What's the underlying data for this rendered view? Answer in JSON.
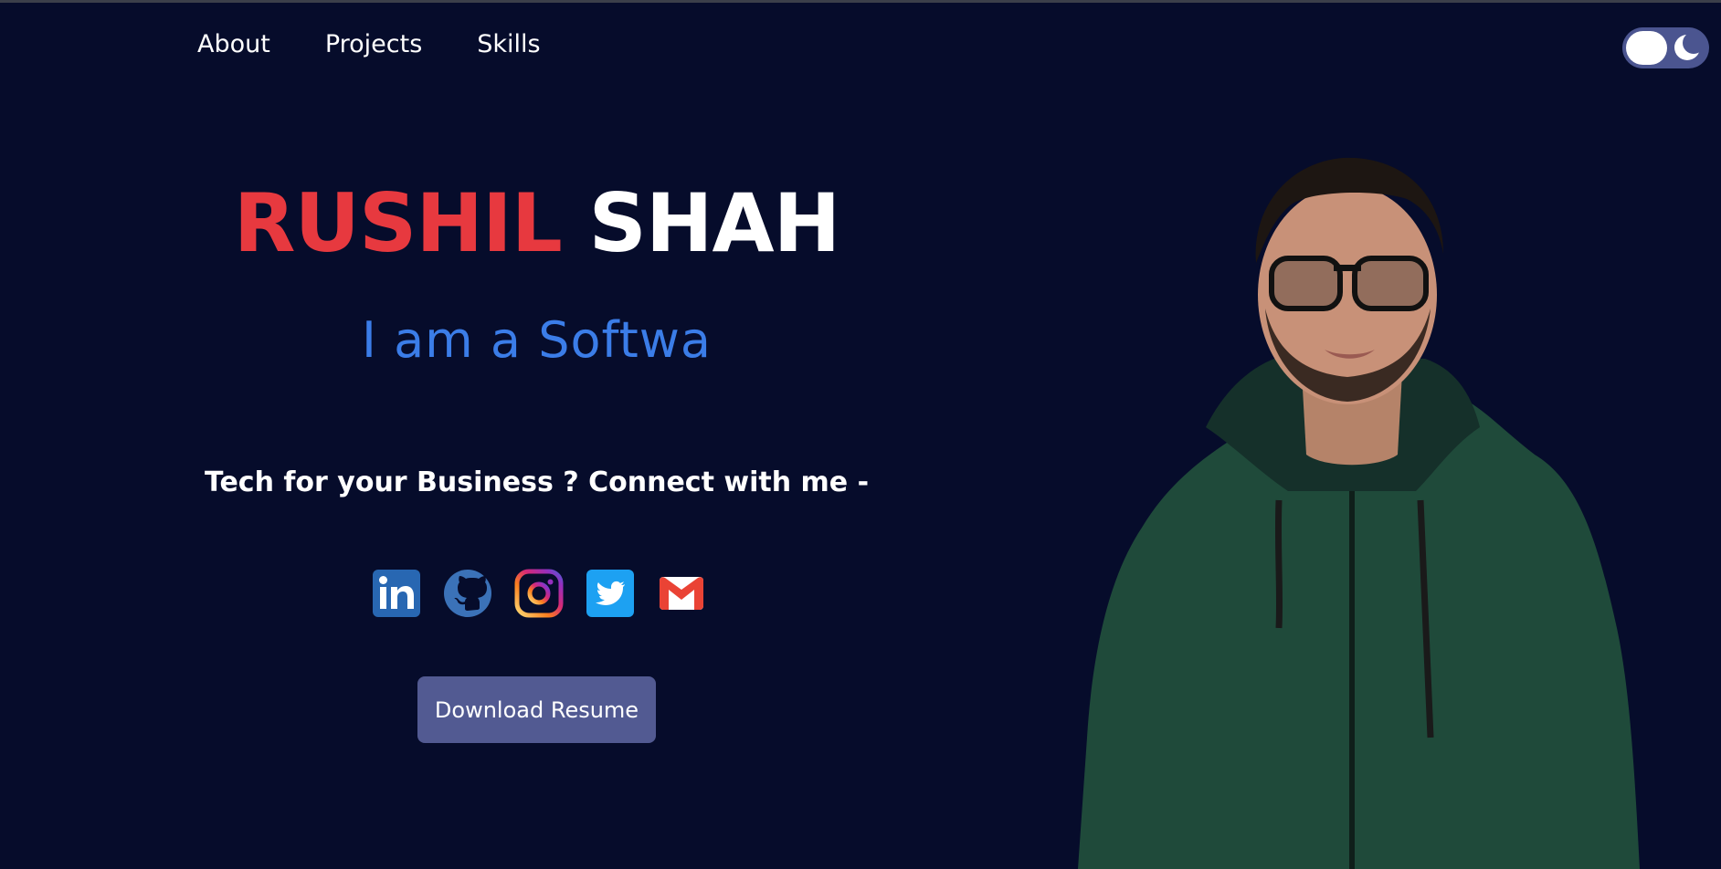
{
  "nav": {
    "items": [
      {
        "label": "About"
      },
      {
        "label": "Projects"
      },
      {
        "label": "Skills"
      }
    ]
  },
  "theme_toggle": {
    "mode": "dark",
    "icon": "moon-icon"
  },
  "hero": {
    "first_name": "RUSHIL",
    "last_name": "SHAH",
    "typed_text": "I am a Softwa",
    "connect_text": "Tech for your Business ? Connect with me -",
    "resume_label": "Download Resume"
  },
  "socials": [
    {
      "name": "linkedin-icon",
      "color": "#2867b2"
    },
    {
      "name": "github-icon",
      "color": "#4078c0"
    },
    {
      "name": "instagram-icon",
      "color": "#c13584"
    },
    {
      "name": "twitter-icon",
      "color": "#1da1f2"
    },
    {
      "name": "gmail-icon",
      "color": "#ea4335"
    }
  ],
  "colors": {
    "background": "#060c2b",
    "accent_red": "#e7393f",
    "accent_blue": "#3b7de8",
    "button": "#525a92"
  }
}
